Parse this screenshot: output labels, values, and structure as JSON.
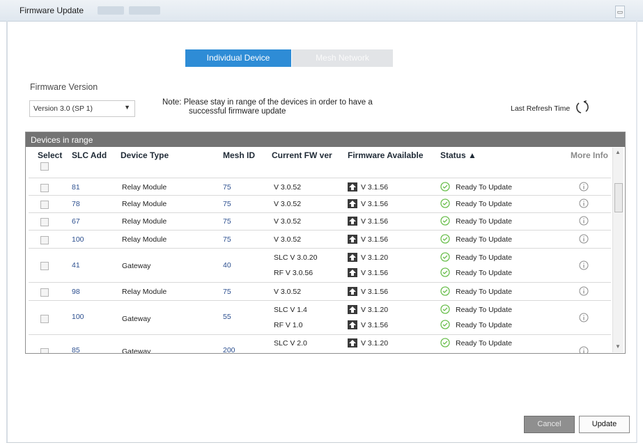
{
  "window": {
    "title": "Firmware Update"
  },
  "tabs": [
    {
      "label": "Individual Device"
    },
    {
      "label": "Mesh Network"
    }
  ],
  "firmware_version": {
    "label": "Firmware Version",
    "selected": "Version 3.0 (SP 1)"
  },
  "note": {
    "line1": "Note: Please stay in range of the devices in order to have a",
    "line2": "successful firmware update"
  },
  "refresh": {
    "label": "Last Refresh Time"
  },
  "grid": {
    "title": "Devices in range",
    "columns": {
      "select": "Select",
      "slc_add": "SLC Add",
      "device_type": "Device Type",
      "mesh_id": "Mesh ID",
      "current_fw": "Current FW ver",
      "firmware_available": "Firmware Available",
      "status": "Status ▲",
      "more_info": "More Info"
    },
    "rows": [
      {
        "slc": "81",
        "type": "Relay Module",
        "mesh": "75",
        "fw": [
          "V 3.0.52"
        ],
        "avail": [
          "V 3.1.56"
        ],
        "status": [
          "Ready To Update"
        ]
      },
      {
        "slc": "78",
        "type": "Relay Module",
        "mesh": "75",
        "fw": [
          "V 3.0.52"
        ],
        "avail": [
          "V 3.1.56"
        ],
        "status": [
          "Ready To Update"
        ]
      },
      {
        "slc": "67",
        "type": "Relay Module",
        "mesh": "75",
        "fw": [
          "V 3.0.52"
        ],
        "avail": [
          "V 3.1.56"
        ],
        "status": [
          "Ready To Update"
        ]
      },
      {
        "slc": "100",
        "type": "Relay Module",
        "mesh": "75",
        "fw": [
          "V 3.0.52"
        ],
        "avail": [
          "V 3.1.56"
        ],
        "status": [
          "Ready To Update"
        ]
      },
      {
        "slc": "41",
        "type": "Gateway",
        "mesh": "40",
        "fw": [
          "SLC V 3.0.20",
          "RF  V 3.0.56"
        ],
        "avail": [
          "V 3.1.20",
          "V 3.1.56"
        ],
        "status": [
          "Ready To Update",
          "Ready To Update"
        ]
      },
      {
        "slc": "98",
        "type": "Relay Module",
        "mesh": "75",
        "fw": [
          "V 3.0.52"
        ],
        "avail": [
          "V 3.1.56"
        ],
        "status": [
          "Ready To Update"
        ]
      },
      {
        "slc": "100",
        "type": "Gateway",
        "mesh": "55",
        "fw": [
          "SLC V 1.4",
          "RF  V 1.0"
        ],
        "avail": [
          "V 3.1.20",
          "V 3.1.56"
        ],
        "status": [
          "Ready To Update",
          "Ready To Update"
        ]
      },
      {
        "slc": "85",
        "type": "Gateway",
        "mesh": "200",
        "fw": [
          "SLC V 2.0"
        ],
        "avail": [
          "V 3.1.20"
        ],
        "status": [
          "Ready To Update"
        ]
      }
    ]
  },
  "buttons": {
    "cancel": "Cancel",
    "update": "Update"
  },
  "colors": {
    "accent": "#2e8cd6",
    "header": "#737373",
    "ok": "#6bbf4e",
    "link_blue": "#2c4f8f"
  }
}
